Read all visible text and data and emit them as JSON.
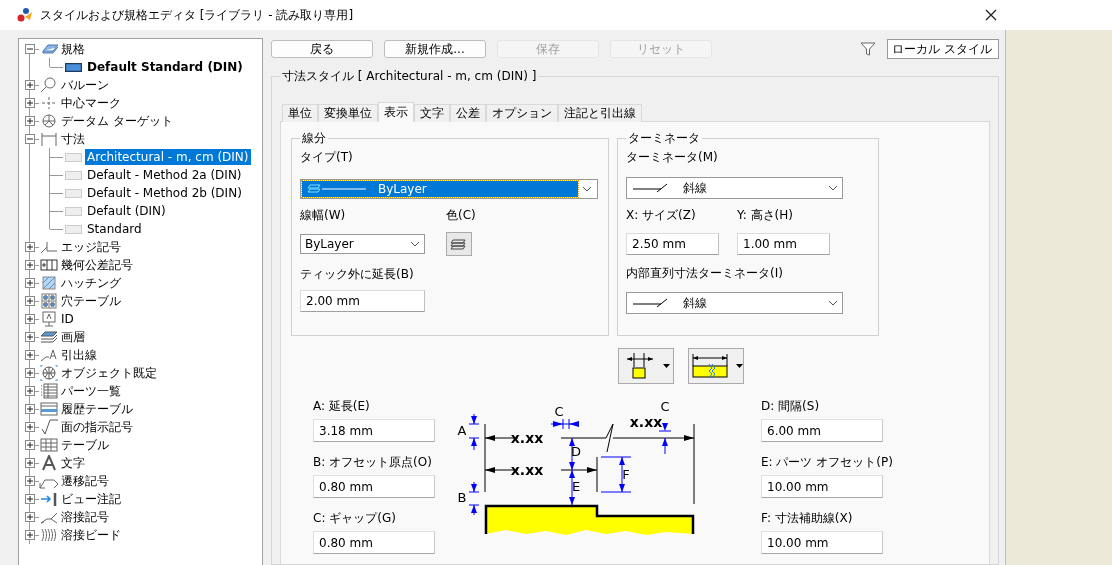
{
  "window": {
    "title": "スタイルおよび規格エディタ [ライブラリ - 読み取り専用]"
  },
  "tree": [
    {
      "label": "規格",
      "expanded": true,
      "selected": false,
      "children": [
        {
          "label": "Default Standard (DIN)",
          "selected": false,
          "active": true
        }
      ]
    },
    {
      "label": "バルーン",
      "expanded": false,
      "selected": false
    },
    {
      "label": "中心マーク",
      "expanded": false,
      "selected": false
    },
    {
      "label": "データム ターゲット",
      "expanded": false,
      "selected": false
    },
    {
      "label": "寸法",
      "expanded": true,
      "selected": false,
      "children": [
        {
          "label": "Architectural - m, cm (DIN)",
          "selected": true,
          "active": false
        },
        {
          "label": "Default - Method 2a (DIN)",
          "selected": false,
          "active": false
        },
        {
          "label": "Default - Method 2b (DIN)",
          "selected": false,
          "active": false
        },
        {
          "label": "Default (DIN)",
          "selected": false,
          "active": false
        },
        {
          "label": "Standard",
          "selected": false,
          "active": false
        }
      ]
    },
    {
      "label": "エッジ記号",
      "expanded": false,
      "selected": false
    },
    {
      "label": "幾何公差記号",
      "expanded": false,
      "selected": false
    },
    {
      "label": "ハッチング",
      "expanded": false,
      "selected": false
    },
    {
      "label": "穴テーブル",
      "expanded": false,
      "selected": false
    },
    {
      "label": "ID",
      "expanded": false,
      "selected": false
    },
    {
      "label": "画層",
      "expanded": false,
      "selected": false
    },
    {
      "label": "引出線",
      "expanded": false,
      "selected": false
    },
    {
      "label": "オブジェクト既定",
      "expanded": false,
      "selected": false
    },
    {
      "label": "パーツ一覧",
      "expanded": false,
      "selected": false
    },
    {
      "label": "履歴テーブル",
      "expanded": false,
      "selected": false
    },
    {
      "label": "面の指示記号",
      "expanded": false,
      "selected": false
    },
    {
      "label": "テーブル",
      "expanded": false,
      "selected": false
    },
    {
      "label": "文字",
      "expanded": false,
      "selected": false
    },
    {
      "label": "遷移記号",
      "expanded": false,
      "selected": false
    },
    {
      "label": "ビュー注記",
      "expanded": false,
      "selected": false
    },
    {
      "label": "溶接記号",
      "expanded": false,
      "selected": false
    },
    {
      "label": "溶接ビード",
      "expanded": false,
      "selected": false
    }
  ],
  "toolbar": {
    "buttons": [
      {
        "label": "戻る",
        "disabled": false
      },
      {
        "label": "新規作成...",
        "disabled": false
      },
      {
        "label": "保存",
        "disabled": true
      },
      {
        "label": "リセット",
        "disabled": true
      }
    ],
    "filter": {
      "value": "ローカル スタイル"
    }
  },
  "style_group": {
    "title": "寸法スタイル [ Architectural - m, cm (DIN) ]"
  },
  "tabs": [
    {
      "label": "単位",
      "selected": false
    },
    {
      "label": "変換単位",
      "selected": false
    },
    {
      "label": "表示",
      "selected": true
    },
    {
      "label": "文字",
      "selected": false
    },
    {
      "label": "公差",
      "selected": false
    },
    {
      "label": "オプション",
      "selected": false
    },
    {
      "label": "注記と引出線",
      "selected": false
    }
  ],
  "line_group": {
    "title": "線分",
    "type": {
      "label": "タイプ(T)",
      "value": "ByLayer",
      "highlighted": true
    },
    "width": {
      "label": "線幅(W)",
      "value": "ByLayer"
    },
    "color": {
      "label": "色(C)"
    },
    "extension": {
      "label": "ティック外に延長(B)",
      "value": "2.00 mm"
    }
  },
  "terminator_group": {
    "title": "ターミネータ",
    "terminator": {
      "label": "ターミネータ(M)",
      "value": "斜線"
    },
    "x_size": {
      "label": "X: サイズ(Z)",
      "value": "2.50 mm"
    },
    "y_height": {
      "label": "Y: 高さ(H)",
      "value": "1.00 mm"
    },
    "inner": {
      "label": "内部直列寸法ターミネータ(I)",
      "value": "斜線"
    }
  },
  "left_fields": [
    {
      "label": "A: 延長(E)",
      "value": "3.18 mm"
    },
    {
      "label": "B: オフセット原点(O)",
      "value": "0.80 mm"
    },
    {
      "label": "C: ギャップ(G)",
      "value": "0.80 mm"
    }
  ],
  "right_fields": [
    {
      "label": "D: 間隔(S)",
      "value": "6.00 mm"
    },
    {
      "label": "E: パーツ オフセット(P)",
      "value": "10.00 mm"
    },
    {
      "label": "F: 寸法補助線(X)",
      "value": "10.00 mm"
    }
  ],
  "diagram_labels": [
    "A",
    "B",
    "C",
    "C",
    "D",
    "E",
    "F",
    "x.xx",
    "x.xx",
    "x.xx"
  ]
}
